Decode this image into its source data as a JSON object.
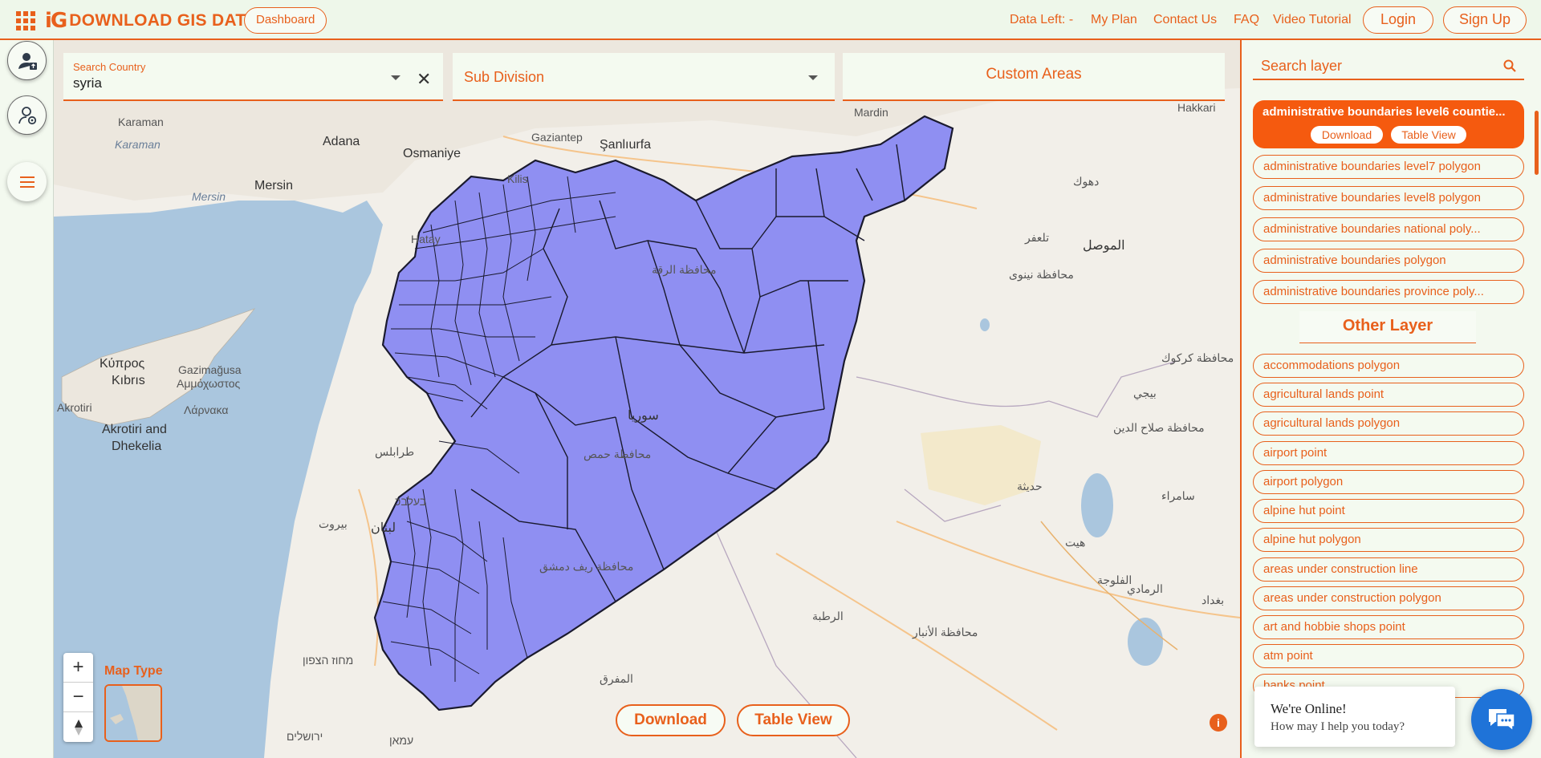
{
  "header": {
    "logo_mark": "iG",
    "logo_text": "DOWNLOAD GIS DATA",
    "dashboard_label": "Dashboard",
    "data_left": "Data Left: -",
    "my_plan": "My Plan",
    "contact_us": "Contact Us",
    "faq": "FAQ",
    "video_tutorial": "Video Tutorial",
    "login": "Login",
    "sign_up": "Sign Up"
  },
  "search": {
    "country_label": "Search Country",
    "country_value": "syria",
    "subdivision_label": "Sub Division",
    "custom_areas_label": "Custom Areas"
  },
  "map": {
    "maptype_label": "Map Type",
    "zoom_in": "+",
    "zoom_out": "−",
    "download_label": "Download",
    "table_view_label": "Table View",
    "labels": [
      {
        "text": "Adana",
        "cls": "big"
      },
      {
        "text": "Osmaniye",
        "cls": "big"
      },
      {
        "text": "Şanlıurfa",
        "cls": "big"
      },
      {
        "text": "Mersin",
        "cls": "big"
      },
      {
        "text": "Karaman",
        "cls": ""
      },
      {
        "text": "Kilis",
        "cls": ""
      },
      {
        "text": "Gaziantep",
        "cls": ""
      },
      {
        "text": "Hatay",
        "cls": ""
      },
      {
        "text": "Mardin",
        "cls": ""
      },
      {
        "text": "Κύπρος",
        "cls": "big"
      },
      {
        "text": "Kıbrıs",
        "cls": "big"
      },
      {
        "text": "Gazimağusa",
        "cls": ""
      },
      {
        "text": "Αμμόχωστος",
        "cls": ""
      },
      {
        "text": "Λάρνακα",
        "cls": ""
      },
      {
        "text": "Akrotiri and",
        "cls": "big"
      },
      {
        "text": "Dhekelia",
        "cls": "big"
      },
      {
        "text": "سوريا",
        "cls": "big"
      },
      {
        "text": "محافظة حمص",
        "cls": ""
      },
      {
        "text": "محافظة ريف دمشق",
        "cls": ""
      },
      {
        "text": "محافظة الرقة",
        "cls": ""
      },
      {
        "text": "الموصل",
        "cls": "big"
      },
      {
        "text": "محافظة نينوى",
        "cls": ""
      },
      {
        "text": "محافظة الأنبار",
        "cls": ""
      },
      {
        "text": "بيروت",
        "cls": ""
      },
      {
        "text": "لبنان",
        "cls": "big"
      },
      {
        "text": "طرابلس",
        "cls": ""
      },
      {
        "text": "בעלבכ",
        "cls": ""
      },
      {
        "text": "ירושלים",
        "cls": ""
      },
      {
        "text": "מחוז הצפון",
        "cls": ""
      },
      {
        "text": "עמאן",
        "cls": ""
      },
      {
        "text": "الرطبة",
        "cls": ""
      },
      {
        "text": "المفرق",
        "cls": ""
      },
      {
        "text": "الفلوجة",
        "cls": ""
      },
      {
        "text": "هيت",
        "cls": ""
      },
      {
        "text": "حديثة",
        "cls": ""
      },
      {
        "text": "دهوك",
        "cls": ""
      },
      {
        "text": "محافظة صلاح الدين",
        "cls": ""
      },
      {
        "text": "محافظة كركوك",
        "cls": ""
      },
      {
        "text": "بغداد",
        "cls": ""
      },
      {
        "text": "Hakkari",
        "cls": ""
      },
      {
        "text": "تلعفر",
        "cls": ""
      },
      {
        "text": "سامراء",
        "cls": ""
      },
      {
        "text": "بيجي",
        "cls": ""
      },
      {
        "text": "الرمادي",
        "cls": ""
      },
      {
        "text": "Akrotiri",
        "cls": ""
      },
      {
        "text": "Mersin",
        "cls": "sea"
      },
      {
        "text": "Karaman",
        "cls": "sea"
      }
    ]
  },
  "layers": {
    "search_placeholder": "Search layer",
    "active": {
      "title": "administrative boundaries level6 countie...",
      "download": "Download",
      "table_view": "Table View"
    },
    "admin_items": [
      "administrative boundaries level7 polygon",
      "administrative boundaries level8 polygon",
      "administrative boundaries national poly...",
      "administrative boundaries polygon",
      "administrative boundaries province poly..."
    ],
    "other_layer_title": "Other Layer",
    "other_items": [
      "accommodations polygon",
      "agricultural lands point",
      "agricultural lands polygon",
      "airport point",
      "airport polygon",
      "alpine hut point",
      "alpine hut polygon",
      "areas under construction line",
      "areas under construction polygon",
      "art and hobbie shops point",
      "atm point",
      "banks point"
    ]
  },
  "chat": {
    "line1": "We're Online!",
    "line2": "How may I help you today?"
  },
  "colors": {
    "accent": "#e8601c",
    "country_fill": "#8f8ff2",
    "sea": "#aac6de"
  }
}
